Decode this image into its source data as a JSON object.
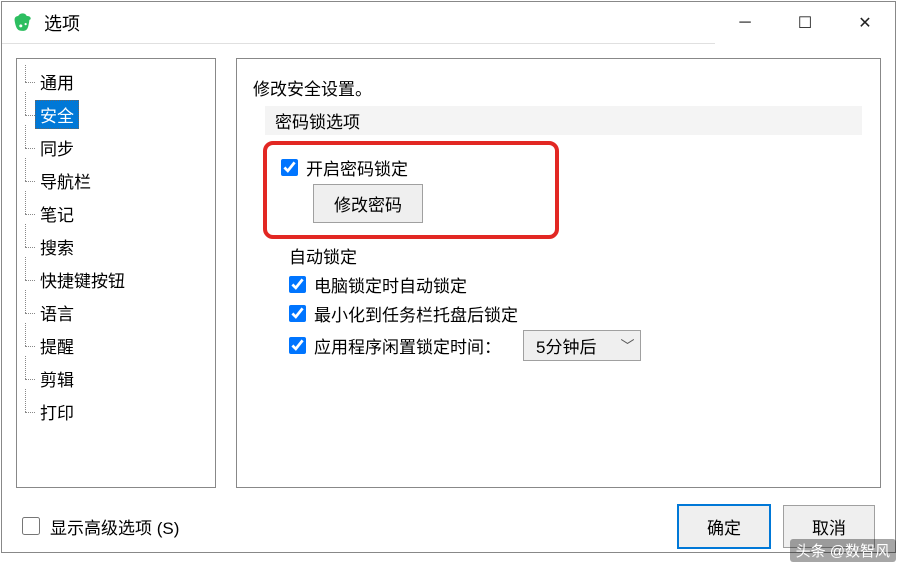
{
  "title": "选项",
  "sidebar": {
    "items": [
      {
        "label": "通用"
      },
      {
        "label": "安全"
      },
      {
        "label": "同步"
      },
      {
        "label": "导航栏"
      },
      {
        "label": "笔记"
      },
      {
        "label": "搜索"
      },
      {
        "label": "快捷键按钮"
      },
      {
        "label": "语言"
      },
      {
        "label": "提醒"
      },
      {
        "label": "剪辑"
      },
      {
        "label": "打印"
      }
    ],
    "selected_index": 1
  },
  "main": {
    "heading": "修改安全设置。",
    "password_section_label": "密码锁选项",
    "enable_password_label": "开启密码锁定",
    "change_password_btn": "修改密码",
    "auto_lock_label": "自动锁定",
    "lock_on_pc_lock": "电脑锁定时自动锁定",
    "lock_on_minimize": "最小化到任务栏托盘后锁定",
    "idle_lock_label": "应用程序闲置锁定时间：",
    "idle_lock_value": "5分钟后"
  },
  "footer": {
    "show_advanced": "显示高级选项 (S)",
    "ok": "确定",
    "cancel": "取消"
  },
  "watermark": "头条 @数智风"
}
